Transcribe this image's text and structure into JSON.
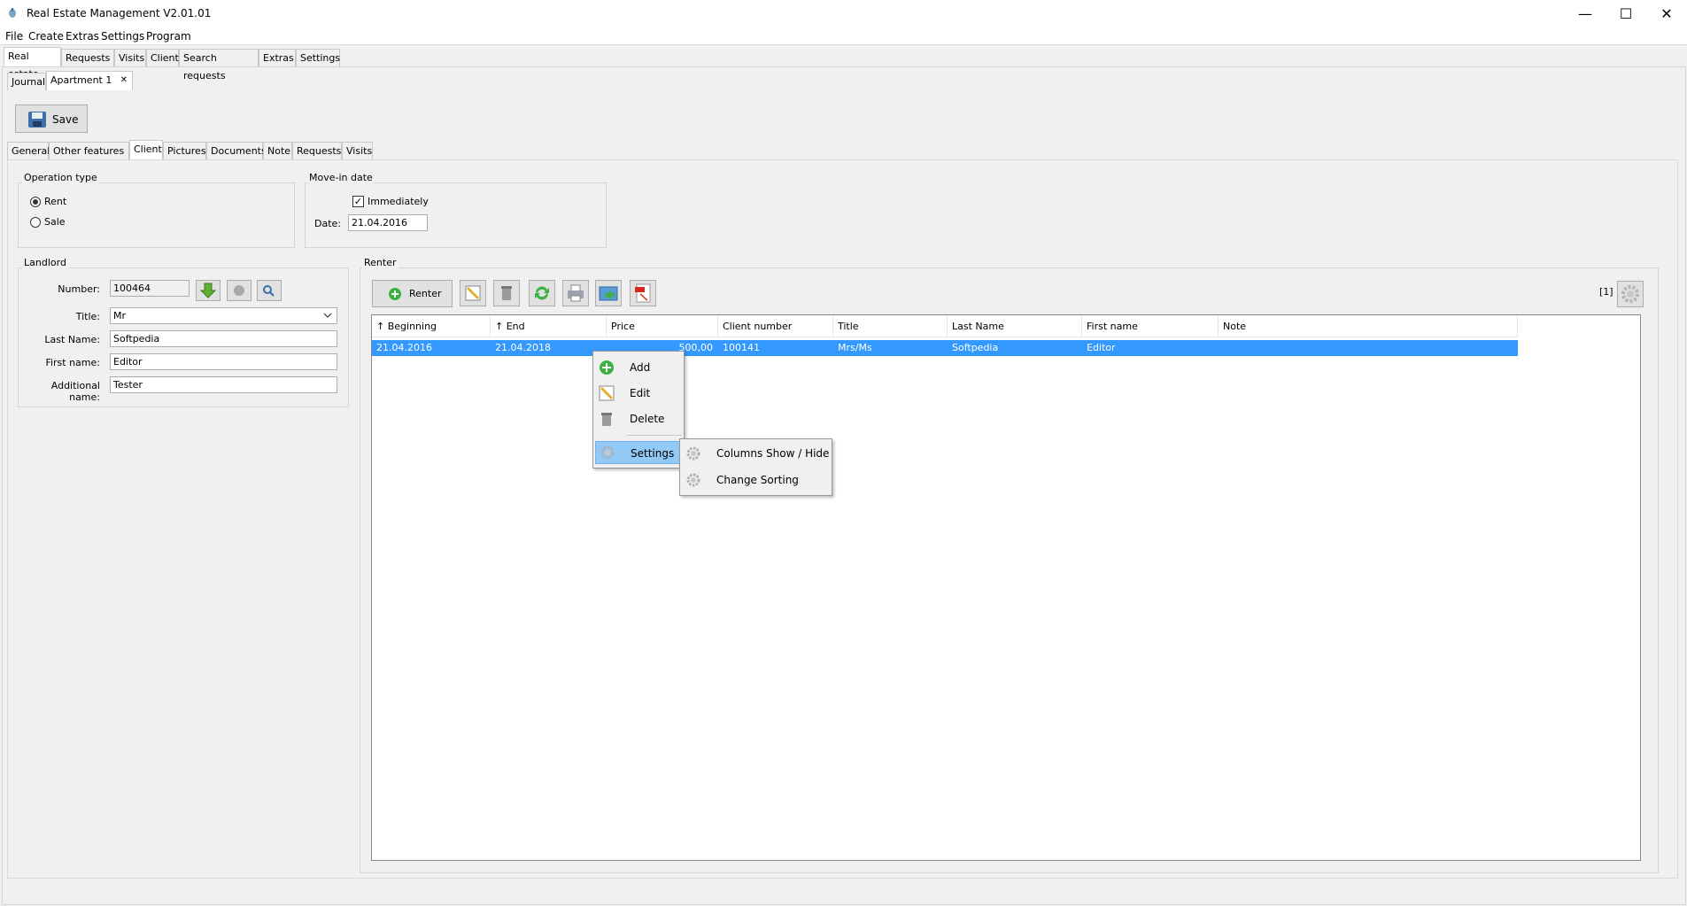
{
  "window": {
    "title": "Real Estate Management V2.01.01",
    "minimize": "—",
    "maximize": "☐",
    "close": "✕"
  },
  "menubar": [
    "File",
    "Create",
    "Extras",
    "Settings",
    "Program"
  ],
  "main_tabs": [
    "Real estate",
    "Requests",
    "Visits",
    "Client",
    "Search requests",
    "Extras",
    "Settings"
  ],
  "doc_tabs": {
    "journal": "Journal",
    "apartment": "Apartment 1",
    "close": "✕"
  },
  "toolbar": {
    "save_label": "Save"
  },
  "detail_tabs": [
    "General",
    "Other features",
    "Client",
    "Pictures",
    "Documents",
    "Note",
    "Requests",
    "Visits"
  ],
  "operation_type": {
    "label": "Operation type",
    "rent": "Rent",
    "sale": "Sale",
    "selected": "Rent"
  },
  "move_in": {
    "label": "Move-in date",
    "immediately": "Immediately",
    "checked": true,
    "date_label": "Date:",
    "date_value": "21.04.2016"
  },
  "landlord": {
    "label": "Landlord",
    "number_label": "Number:",
    "number": "100464",
    "title_label": "Title:",
    "title": "Mr",
    "last_name_label": "Last Name:",
    "last_name": "Softpedia",
    "first_name_label": "First name:",
    "first_name": "Editor",
    "additional_name_label": "Additional name:",
    "additional_name": "Tester"
  },
  "renter": {
    "label": "Renter",
    "add_label": "Renter",
    "count": "[1]",
    "columns": [
      "↑ Beginning",
      "↑ End",
      "Price",
      "Client number",
      "Title",
      "Last Name",
      "First name",
      "Note"
    ],
    "rows": [
      {
        "beginning": "21.04.2016",
        "end": "21.04.2018",
        "price": "500,00",
        "client_number": "100141",
        "title": "Mrs/Ms",
        "last_name": "Softpedia",
        "first_name": "Editor",
        "note": ""
      }
    ]
  },
  "context_menu": {
    "add": "Add",
    "edit": "Edit",
    "delete": "Delete",
    "settings": "Settings"
  },
  "submenu": {
    "columns": "Columns Show / Hide",
    "sorting": "Change Sorting"
  },
  "colors": {
    "selection": "#3399ff",
    "add_green": "#3cb043",
    "pdf_red": "#d9261c",
    "edit_yellow": "#f2d16b"
  }
}
